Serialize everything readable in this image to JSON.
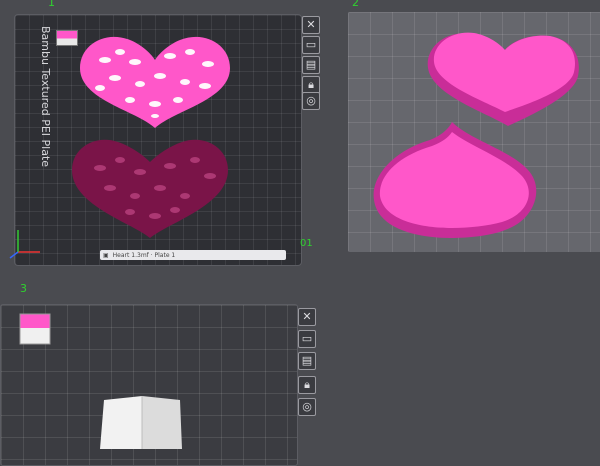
{
  "plates": [
    {
      "index_label": "1",
      "name": "Bambu Textured PEI Plate",
      "number": "01"
    },
    {
      "index_label": "2"
    },
    {
      "index_label": "3"
    }
  ],
  "toolbar_icons": [
    "close-icon",
    "image-icon",
    "layout-icon",
    "lock-icon",
    "settings-icon"
  ],
  "statusbar": {
    "text": "Heart 1.3mf  ·  Plate 1"
  },
  "colors": {
    "pink": "#ff57c9",
    "maroon": "#7a1448",
    "plate_dark": "#2e2f34"
  }
}
